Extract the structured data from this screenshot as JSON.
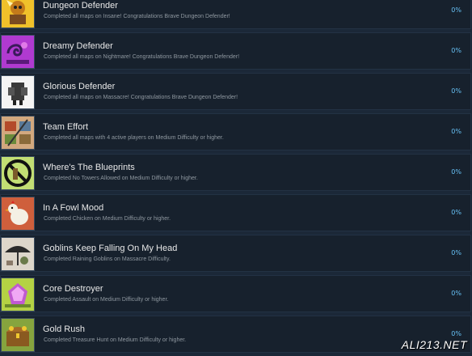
{
  "achievements": [
    {
      "title": "Dungeon Defender",
      "desc": "Completed all maps on Insane! Congratulations Brave Dungeon Defender!",
      "percent": "0%",
      "icon": "gold-warrior-icon",
      "bg": "#e6b01e"
    },
    {
      "title": "Dreamy Defender",
      "desc": "Completed all maps on Nightmare! Congratulations Brave Dungeon Defender!",
      "percent": "0%",
      "icon": "purple-swirl-icon",
      "bg": "#9b2fc0"
    },
    {
      "title": "Glorious Defender",
      "desc": "Completed all maps on Massacre! Congratulations Brave Dungeon Defender!",
      "percent": "0%",
      "icon": "armored-tower-icon",
      "bg": "#f2f2f2"
    },
    {
      "title": "Team Effort",
      "desc": "Completed all maps with 4 active players on Medium Difficulty or higher.",
      "percent": "0%",
      "icon": "team-hammers-icon",
      "bg": "#c9a27a"
    },
    {
      "title": "Where's The Blueprints",
      "desc": "Completed No Towers Allowed on Medium Difficulty or higher.",
      "percent": "0%",
      "icon": "no-towers-icon",
      "bg": "#b8d66a"
    },
    {
      "title": "In A Fowl Mood",
      "desc": "Completed Chicken on Medium Difficulty or higher.",
      "percent": "0%",
      "icon": "chicken-icon",
      "bg": "#c85a3a"
    },
    {
      "title": "Goblins Keep Falling On My Head",
      "desc": "Completed Raining Goblins on Massacre Difficulty.",
      "percent": "0%",
      "icon": "umbrella-goblin-icon",
      "bg": "#d9d2c6"
    },
    {
      "title": "Core Destroyer",
      "desc": "Completed Assault on Medium Difficulty or higher.",
      "percent": "0%",
      "icon": "crystal-core-icon",
      "bg": "#a8c83c"
    },
    {
      "title": "Gold Rush",
      "desc": "Completed Treasure Hunt on Medium Difficulty or higher.",
      "percent": "0%",
      "icon": "treasure-chest-icon",
      "bg": "#7a9a3a"
    }
  ],
  "watermark": "ALI213.NET"
}
